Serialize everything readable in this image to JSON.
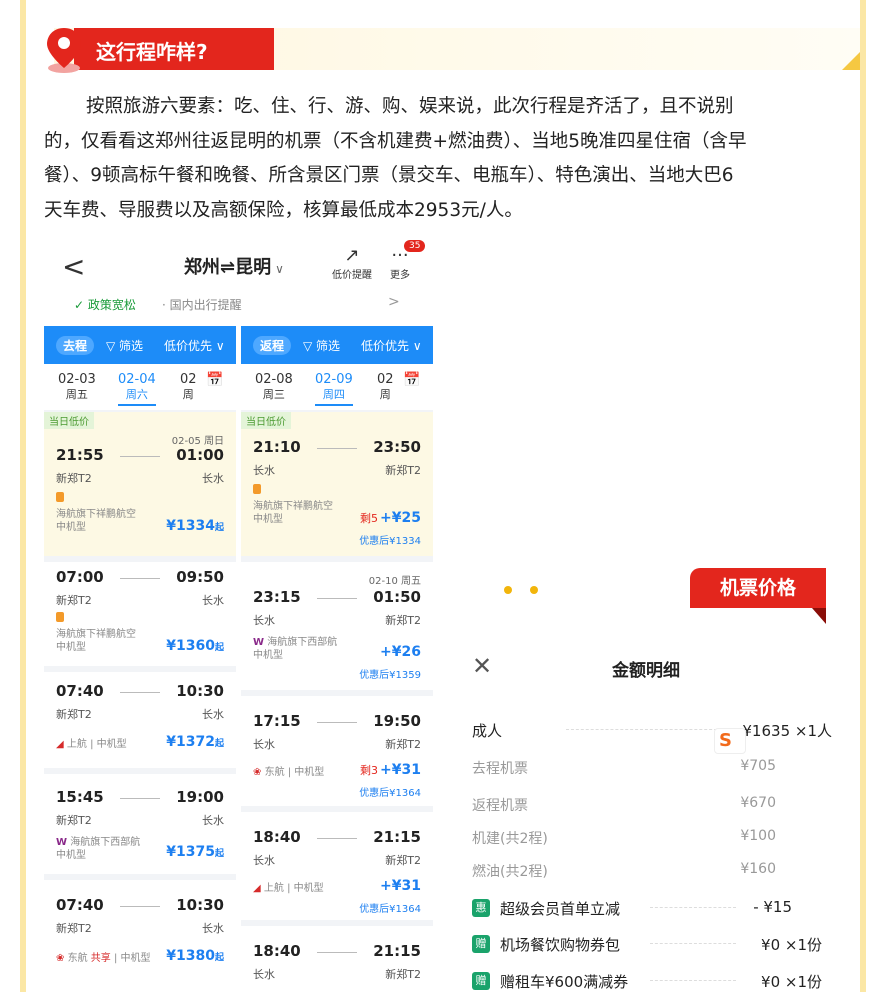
{
  "section": {
    "title": "这行程咋样?"
  },
  "paragraph": {
    "lines": [
      "按照旅游六要素：吃、住、行、游、购、娱来说，此次行程是齐活了，且不说别",
      "的，仅看看这郑州往返昆明的机票（不含机建费+燃油费）、当地5晚准四星住宿（含早",
      "餐）、9顿高标午餐和晚餐、所含景区门票（景交车、电瓶车）、特色演出、当地大巴6",
      "天车费、导服费以及高额保险，核算最低成本2953元/人。"
    ]
  },
  "app": {
    "back": "<",
    "route": "郑州⇌昆明",
    "route_arrow": "∨",
    "price_alert": {
      "label": "低价提醒"
    },
    "more": {
      "label": "更多",
      "badge": "35"
    },
    "policy": {
      "check": "✓ 政策宽松",
      "text": "· 国内出行提醒",
      "chevron": ">"
    },
    "outbound": {
      "pill": "去程",
      "filter": "▽ 筛选",
      "sort": "低价优先 ∨",
      "dates": [
        {
          "date": "02-03",
          "day": "周五"
        },
        {
          "date": "02-04",
          "day": "周六"
        },
        {
          "date": "02",
          "day": "周"
        }
      ],
      "flights": [
        {
          "tag": "当日低价",
          "next_day": "02-05 周日",
          "dep": "21:55",
          "arr": "01:00",
          "from": "新郑T2",
          "to": "长水",
          "airline": "海航旗下祥鹏航空",
          "plane": "中机型",
          "price": "¥1334",
          "unit": "起"
        },
        {
          "dep": "07:00",
          "arr": "09:50",
          "from": "新郑T2",
          "to": "长水",
          "airline": "海航旗下祥鹏航空",
          "plane": "中机型",
          "price": "¥1360",
          "unit": "起"
        },
        {
          "dep": "07:40",
          "arr": "10:30",
          "from": "新郑T2",
          "to": "长水",
          "airline": "上航 | 中机型",
          "price": "¥1372",
          "unit": "起"
        },
        {
          "dep": "15:45",
          "arr": "19:00",
          "from": "新郑T2",
          "to": "长水",
          "airline": "海航旗下西部航",
          "plane": "中机型",
          "price": "¥1375",
          "unit": "起"
        },
        {
          "dep": "07:40",
          "arr": "10:30",
          "from": "新郑T2",
          "to": "长水",
          "airline": "东航",
          "share": "共享",
          "plane": "| 中机型",
          "price": "¥1380",
          "unit": "起"
        }
      ]
    },
    "return": {
      "pill": "返程",
      "filter": "▽ 筛选",
      "sort": "低价优先 ∨",
      "dates": [
        {
          "date": "02-08",
          "day": "周三"
        },
        {
          "date": "02-09",
          "day": "周四"
        },
        {
          "date": "02",
          "day": "周"
        }
      ],
      "flights": [
        {
          "tag": "当日低价",
          "dep": "21:10",
          "arr": "23:50",
          "from": "长水",
          "to": "新郑T2",
          "airline": "海航旗下祥鹏航空",
          "plane": "中机型",
          "left": "剩5",
          "price": "+¥25",
          "discount": "优惠后¥1334"
        },
        {
          "next_day": "02-10 周五",
          "dep": "23:15",
          "arr": "01:50",
          "from": "长水",
          "to": "新郑T2",
          "airline": "海航旗下西部航",
          "plane": "中机型",
          "price": "+¥26",
          "discount": "优惠后¥1359"
        },
        {
          "dep": "17:15",
          "arr": "19:50",
          "from": "长水",
          "to": "新郑T2",
          "airline": "东航 | 中机型",
          "left": "剩3",
          "price": "+¥31",
          "discount": "优惠后¥1364"
        },
        {
          "dep": "18:40",
          "arr": "21:15",
          "from": "长水",
          "to": "新郑T2",
          "airline": "上航 | 中机型",
          "price": "+¥31",
          "discount": "优惠后¥1364"
        },
        {
          "dep": "18:40",
          "arr": "21:15",
          "from": "长水",
          "to": "新郑T2"
        }
      ]
    }
  },
  "ticket_tag": "机票价格",
  "panel": {
    "close": "✕",
    "title": "金额明细",
    "rows": [
      {
        "label": "成人",
        "value": "¥1635 ×1人"
      },
      {
        "label": "去程机票",
        "value": "¥705"
      },
      {
        "label": "返程机票",
        "value": "¥670"
      },
      {
        "label": "机建(共2程)",
        "value": "¥100"
      },
      {
        "label": "燃油(共2程)",
        "value": "¥160"
      }
    ],
    "perks": [
      {
        "icon": "惠",
        "label": "超级会员首单立减",
        "value": "- ¥15"
      },
      {
        "icon": "赠",
        "label": "机场餐饮购物券包",
        "value": "¥0 ×1份"
      },
      {
        "icon": "赠",
        "label": "赠租车¥600满减券",
        "value": "¥0 ×1份"
      }
    ],
    "ime_glyph": "S"
  },
  "colors": {
    "brand_red": "#e3261d",
    "app_blue": "#1d8cf8",
    "frame_yellow": "#fbe7a5"
  }
}
